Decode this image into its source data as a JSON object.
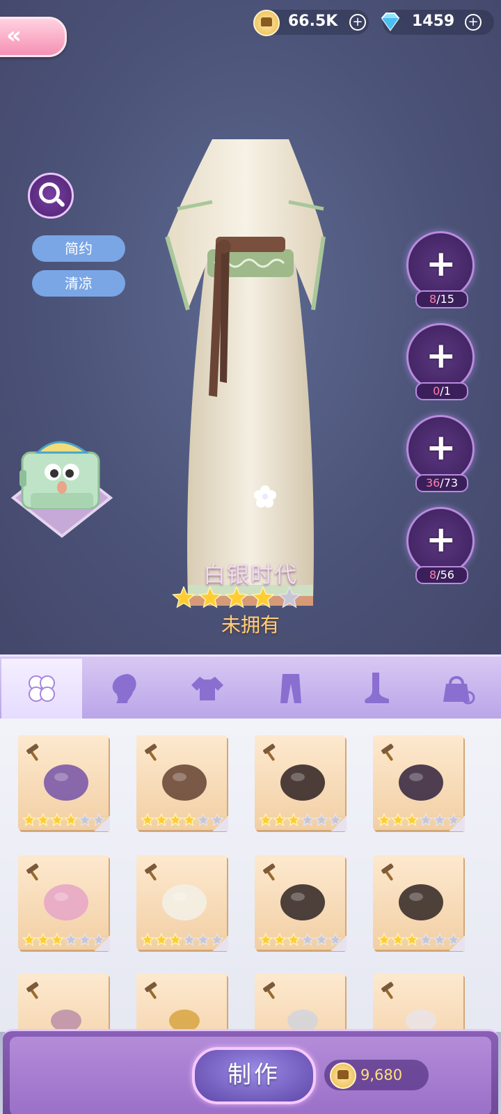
{
  "currency": {
    "gold": "66.5K",
    "diamonds": "1459"
  },
  "tags": [
    "简约",
    "清凉"
  ],
  "item": {
    "name": "白银时代",
    "status": "未拥有",
    "stars": 4,
    "max_stars": 5
  },
  "materials": [
    {
      "have": "8",
      "need": "/15",
      "icon": "vine-necklace-icon"
    },
    {
      "have": "0",
      "need": "/1",
      "icon": "leaf-flower-icon"
    },
    {
      "have": "36",
      "need": "/73",
      "icon": "folded-fabric-icon"
    },
    {
      "have": "8",
      "need": "/56",
      "icon": "leather-icon"
    }
  ],
  "category_tabs": [
    {
      "icon": "clover-icon",
      "active": true
    },
    {
      "icon": "hair-icon",
      "active": false
    },
    {
      "icon": "top-icon",
      "active": false
    },
    {
      "icon": "pants-icon",
      "active": false
    },
    {
      "icon": "foot-icon",
      "active": false
    },
    {
      "icon": "bag-icon",
      "active": false
    }
  ],
  "recipes": [
    {
      "icon": "purple-top-icon",
      "stars": 4
    },
    {
      "icon": "leg-warmers-icon",
      "stars": 4
    },
    {
      "icon": "black-heels-icon",
      "stars": 3
    },
    {
      "icon": "purple-heels-icon",
      "stars": 3
    },
    {
      "icon": "pink-heels-icon",
      "stars": 3
    },
    {
      "icon": "white-gloves-icon",
      "stars": 3
    },
    {
      "icon": "lace-glove-icon",
      "stars": 3
    },
    {
      "icon": "dark-gloves-icon",
      "stars": 3
    },
    {
      "icon": "partial-item-icon",
      "stars": 0
    },
    {
      "icon": "partial-item-icon",
      "stars": 0
    },
    {
      "icon": "partial-item-icon",
      "stars": 0
    },
    {
      "icon": "partial-item-icon",
      "stars": 0
    }
  ],
  "craft": {
    "button_label": "制作",
    "cost": "9,680"
  },
  "colors": {
    "accent_purple": "#8a5fb6",
    "star_gold": "#ffcc33",
    "tag_blue": "#7aa6e6",
    "count_pink": "#ff7fb0"
  }
}
